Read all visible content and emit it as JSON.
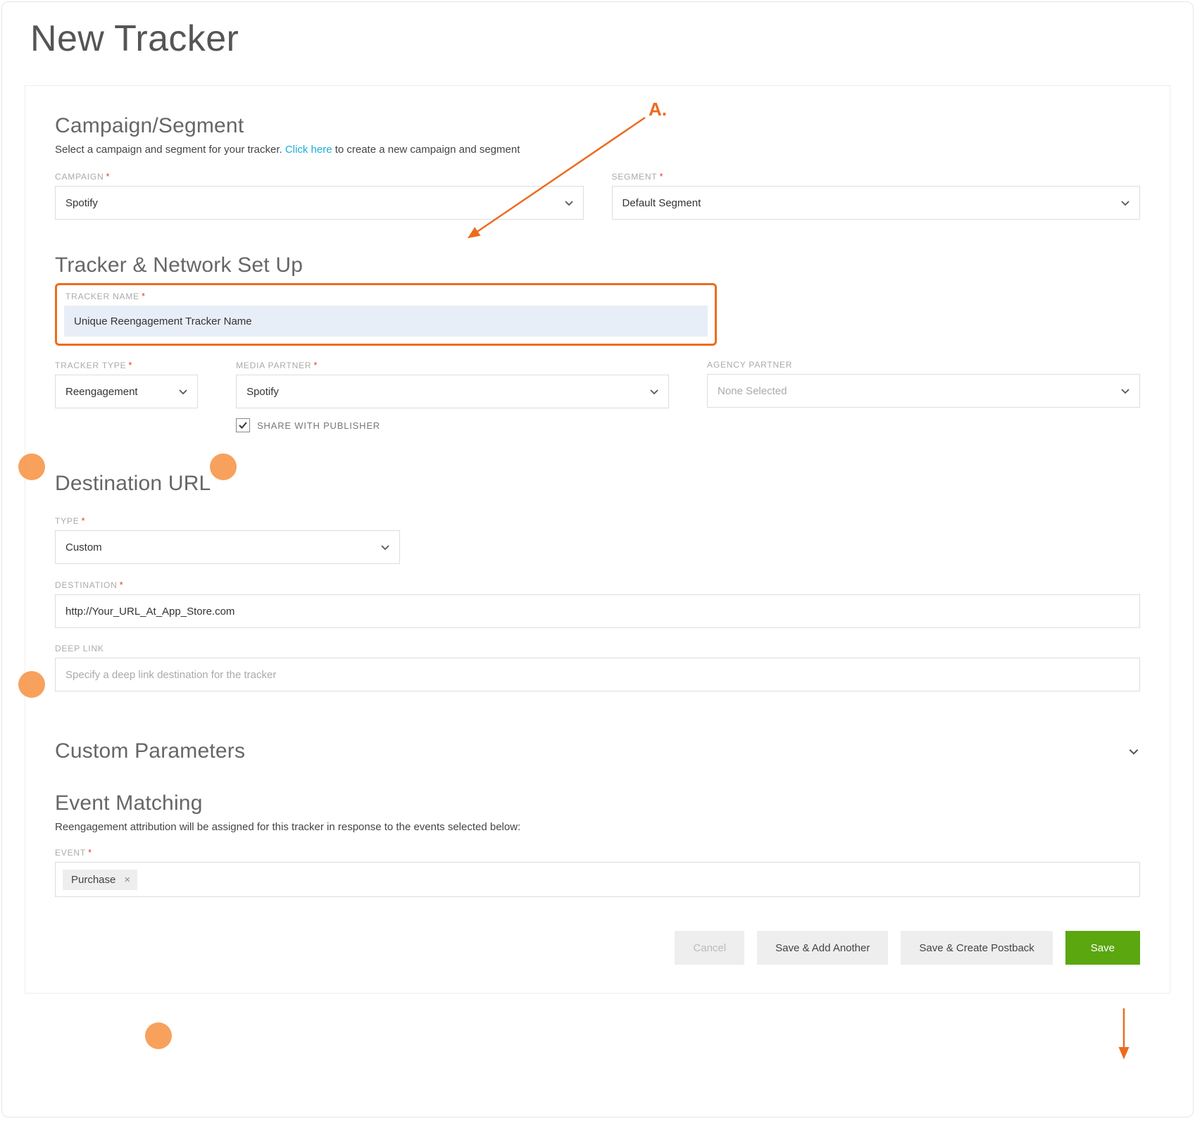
{
  "page_title": "New Tracker",
  "annotation_label": "A.",
  "campaign_segment": {
    "heading": "Campaign/Segment",
    "subtext_prefix": "Select a campaign and segment for your tracker. ",
    "link_text": "Click here",
    "subtext_suffix": " to create a new campaign and segment",
    "campaign_label": "CAMPAIGN",
    "campaign_value": "Spotify",
    "segment_label": "SEGMENT",
    "segment_value": "Default Segment"
  },
  "tracker_setup": {
    "heading": "Tracker & Network Set Up",
    "tracker_name_label": "TRACKER NAME",
    "tracker_name_value": "Unique Reengagement Tracker Name",
    "tracker_type_label": "TRACKER TYPE",
    "tracker_type_value": "Reengagement",
    "media_partner_label": "MEDIA PARTNER",
    "media_partner_value": "Spotify",
    "agency_partner_label": "AGENCY PARTNER",
    "agency_partner_value": "None Selected",
    "share_checkbox_label": "SHARE WITH PUBLISHER",
    "share_checked": true
  },
  "destination": {
    "heading": "Destination URL",
    "type_label": "TYPE",
    "type_value": "Custom",
    "destination_label": "DESTINATION",
    "destination_value": "http://Your_URL_At_App_Store.com",
    "deeplink_label": "DEEP LINK",
    "deeplink_placeholder": "Specify a deep link destination for the tracker"
  },
  "custom_params": {
    "heading": "Custom Parameters"
  },
  "event_matching": {
    "heading": "Event Matching",
    "subtext": "Reengagement attribution will be assigned for this tracker in response to the events selected below:",
    "event_label": "EVENT",
    "chips": [
      "Purchase"
    ]
  },
  "buttons": {
    "cancel": "Cancel",
    "save_add": "Save & Add Another",
    "save_postback": "Save & Create Postback",
    "save": "Save"
  },
  "colors": {
    "accent_orange": "#ed6b1f",
    "link_blue": "#1aaed6",
    "primary_green": "#5aa70f"
  }
}
